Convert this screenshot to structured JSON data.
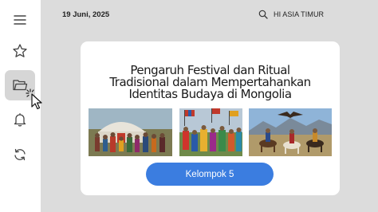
{
  "header": {
    "date": "19 Juni, 2025",
    "user_label": "HI ASIA TIMUR"
  },
  "sidebar": {
    "items": [
      {
        "icon": "menu-icon"
      },
      {
        "icon": "star-icon"
      },
      {
        "icon": "folder-icon",
        "active": true
      },
      {
        "icon": "bell-icon"
      },
      {
        "icon": "refresh-icon"
      }
    ]
  },
  "card": {
    "title_lines": [
      "Pengaruh Festival dan Ritual",
      "Tradisional dalam Mempertahankan",
      "Identitas Budaya di Mongolia"
    ],
    "photos": [
      {
        "icon": "people-in-front-of-yurt-photo"
      },
      {
        "icon": "festival-dancers-with-flags-photo"
      },
      {
        "icon": "horse-riders-with-eagle-photo"
      }
    ],
    "button_label": "Kelompok 5"
  },
  "colors": {
    "accent": "#3b7de0",
    "background": "#dcdcdc",
    "card": "#ffffff",
    "sidebar_active": "#d6d6d6"
  }
}
